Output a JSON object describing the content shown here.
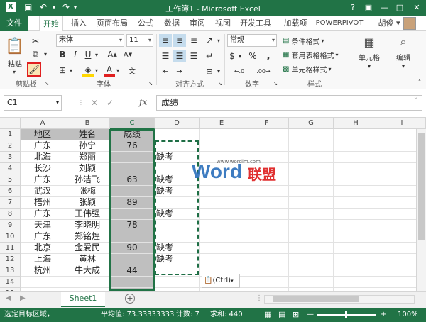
{
  "titlebar": {
    "title": "工作簿1 - Microsoft Excel",
    "help": "?",
    "minimize": "—",
    "restore": "□",
    "close": "✕",
    "ribbon_opts": "▣"
  },
  "tabs": [
    "文件",
    "开始",
    "插入",
    "页面布局",
    "公式",
    "数据",
    "审阅",
    "视图",
    "开发工具",
    "加载项",
    "POWERPIVOT"
  ],
  "user": "胡俊",
  "ribbon": {
    "paste_label": "粘贴",
    "clipboard_label": "剪贴板",
    "font_name": "宋体",
    "font_size": "11",
    "font_label": "字体",
    "bold": "B",
    "italic": "I",
    "underline": "U",
    "grow": "A",
    "shrink": "A",
    "align_label": "对齐方式",
    "number_format": "常规",
    "currency": "$",
    "percent": "%",
    "comma": ",",
    "dec_inc": "←.0",
    "dec_dec": ".00→",
    "number_label": "数字",
    "cond_format": "条件格式",
    "table_format": "套用表格格式",
    "cell_styles": "单元格样式",
    "styles_label": "样式",
    "cells_btn": "单元格",
    "edit_btn": "编辑"
  },
  "formula": {
    "namebox": "C1",
    "fx": "fx",
    "cancel": "✕",
    "enter": "✓",
    "content": "成绩"
  },
  "columns": [
    "A",
    "B",
    "C",
    "D",
    "E",
    "F",
    "G",
    "H",
    "I"
  ],
  "rows": [
    "1",
    "2",
    "3",
    "4",
    "5",
    "6",
    "7",
    "8",
    "9",
    "10",
    "11",
    "12",
    "13",
    "14",
    "15"
  ],
  "data": {
    "A": [
      "地区",
      "广东",
      "北海",
      "长沙",
      "广东",
      "武汉",
      "梧州",
      "广东",
      "天津",
      "广东",
      "北京",
      "上海",
      "杭州",
      "",
      ""
    ],
    "B": [
      "姓名",
      "孙宁",
      "郑丽",
      "刘颖",
      "孙洁飞",
      "张梅",
      "张颖",
      "王伟强",
      "李晓明",
      "郑铭煌",
      "金爱民",
      "黄林",
      "牛大成",
      "",
      ""
    ],
    "C": [
      "成绩",
      "76",
      "",
      "",
      "63",
      "",
      "89",
      "",
      "78",
      "",
      "90",
      "",
      "44",
      "",
      ""
    ],
    "D": [
      "",
      "",
      "缺考",
      "",
      "缺考",
      "缺考",
      "",
      "缺考",
      "",
      "",
      "缺考",
      "缺考",
      "",
      "",
      ""
    ]
  },
  "paste_options": "(Ctrl)",
  "watermark": {
    "brand": "Word",
    "cn": "联盟",
    "url": "www.wordlm.com"
  },
  "sheet_tab": "Sheet1",
  "add_sheet": "+",
  "status": {
    "mode": "选定目标区域，",
    "average": "平均值: 73.33333333",
    "count": "计数: 7",
    "sum": "求和: 440",
    "zoom": "100%",
    "zoom_out": "—",
    "zoom_in": "+"
  },
  "colors": {
    "accent": "#217346",
    "header_gray": "#bfbfbf"
  }
}
